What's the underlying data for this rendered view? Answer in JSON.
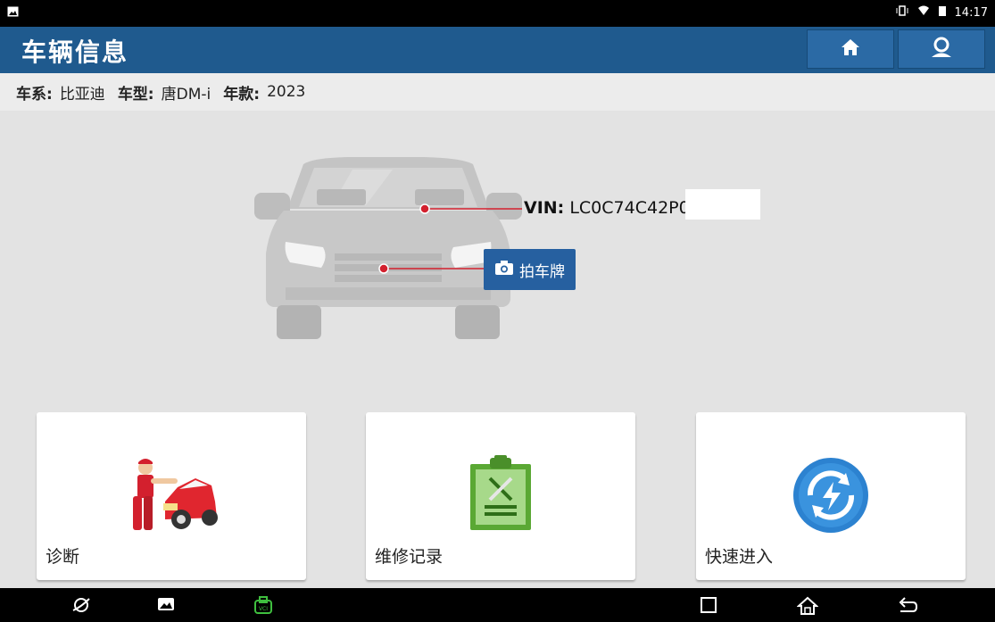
{
  "status_bar": {
    "time": "14:17"
  },
  "header": {
    "title": "车辆信息"
  },
  "vehicle_info": {
    "series_label": "车系:",
    "series_value": "比亚迪",
    "model_label": "车型:",
    "model_value": "唐DM-i",
    "year_label": "年款:",
    "year_value": "2023"
  },
  "car_panel": {
    "vin_label": "VIN:",
    "vin_value": "LC0C74C42P0",
    "plate_button_label": "拍车牌"
  },
  "cards": [
    {
      "label": "诊断",
      "icon": "mechanic-car-icon"
    },
    {
      "label": "维修记录",
      "icon": "repair-clipboard-icon"
    },
    {
      "label": "快速进入",
      "icon": "quick-access-bolt-icon"
    }
  ],
  "colors": {
    "header_bg": "#1f5a8e",
    "button_bg": "#2660a0",
    "accent_red": "#d3202e",
    "card_bg": "#ffffff"
  }
}
